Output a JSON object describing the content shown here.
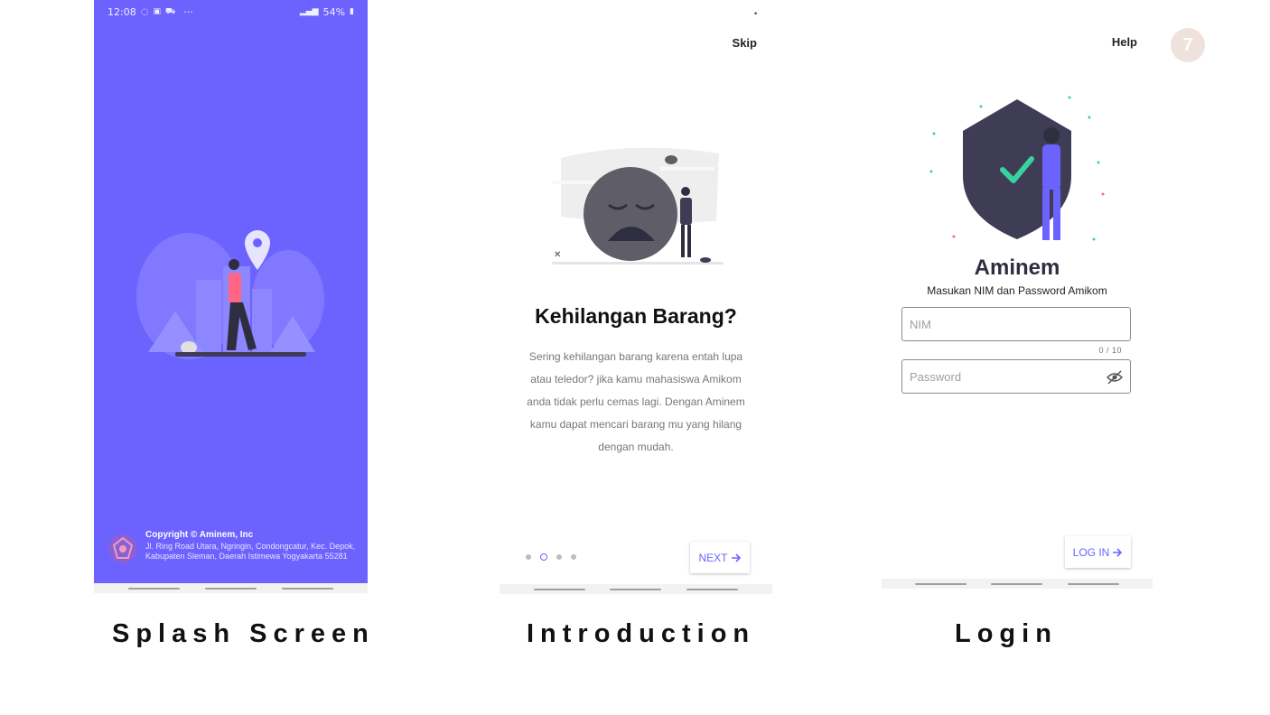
{
  "colors": {
    "accent": "#6c63ff",
    "splash_bg": "#6c63ff",
    "dark": "#2f2e41",
    "success": "#3ad29f"
  },
  "splash": {
    "status_time": "12:08",
    "status_more": "···",
    "status_battery": "54%",
    "copyright": "Copyright © Aminem, Inc",
    "address": "Jl. Ring Road Utara, Ngringin, Condongcatur, Kec. Depok, Kabupaten Sleman, Daerah Istimewa Yogyakarta 55281",
    "caption": "Splash Screen"
  },
  "intro": {
    "skip_label": "Skip",
    "title": "Kehilangan Barang?",
    "body": "Sering kehilangan barang karena entah lupa atau teledor? jika kamu mahasiswa Amikom anda tidak perlu cemas lagi. Dengan Aminem kamu dapat mencari barang mu yang hilang dengan mudah.",
    "pager": {
      "total": 4,
      "active_index": 1
    },
    "next_label": "NEXT",
    "caption": "Introduction"
  },
  "login": {
    "help_label": "Help",
    "app_name": "Aminem",
    "subtitle": "Masukan NIM dan Password Amikom",
    "nim_placeholder": "NIM",
    "nim_counter": "0 / 10",
    "password_placeholder": "Password",
    "login_label": "LOG IN",
    "caption": "Login"
  },
  "page_badge": "7",
  "icons": {
    "next_arrow": "arrow-right-icon",
    "login_arrow": "arrow-right-icon",
    "password_toggle": "eye-off-icon"
  }
}
